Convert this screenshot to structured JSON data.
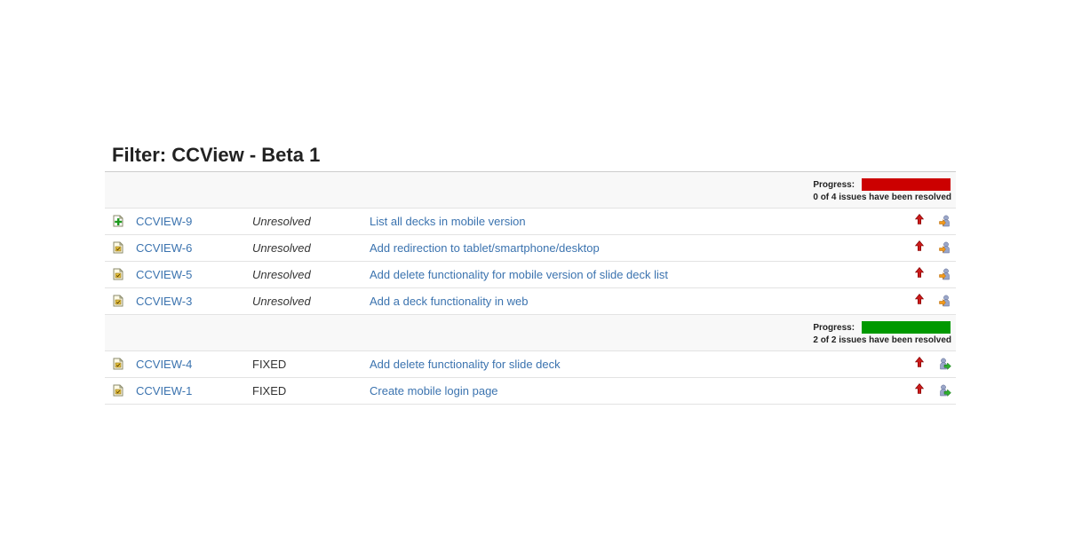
{
  "title": "Filter: CCView - Beta 1",
  "groups": [
    {
      "progress_label": "Progress:",
      "progress_fraction": 0.0,
      "progress_color": "#cc0000",
      "progress_text": "0 of 4 issues have been resolved",
      "issues": [
        {
          "type_icon": "new-feature-icon",
          "key": "CCVIEW-9",
          "status": "Unresolved",
          "summary": "List all decks in mobile version",
          "priority_icon": "priority-major-icon",
          "assignee_icon": "user-assigned-icon"
        },
        {
          "type_icon": "task-icon",
          "key": "CCVIEW-6",
          "status": "Unresolved",
          "summary": "Add redirection to tablet/smartphone/desktop",
          "priority_icon": "priority-major-icon",
          "assignee_icon": "user-assigned-icon"
        },
        {
          "type_icon": "task-icon",
          "key": "CCVIEW-5",
          "status": "Unresolved",
          "summary": "Add delete functionality for mobile version of slide deck list",
          "priority_icon": "priority-major-icon",
          "assignee_icon": "user-assigned-icon"
        },
        {
          "type_icon": "task-icon",
          "key": "CCVIEW-3",
          "status": "Unresolved",
          "summary": "Add a deck functionality in web",
          "priority_icon": "priority-major-icon",
          "assignee_icon": "user-assigned-icon"
        }
      ]
    },
    {
      "progress_label": "Progress:",
      "progress_fraction": 1.0,
      "progress_color": "#009900",
      "progress_text": "2 of 2 issues have been resolved",
      "issues": [
        {
          "type_icon": "task-icon",
          "key": "CCVIEW-4",
          "status": "FIXED",
          "summary": "Add delete functionality for slide deck",
          "priority_icon": "priority-major-icon",
          "assignee_icon": "user-resolved-icon"
        },
        {
          "type_icon": "task-icon",
          "key": "CCVIEW-1",
          "status": "FIXED",
          "summary": "Create mobile login page",
          "priority_icon": "priority-major-icon",
          "assignee_icon": "user-resolved-icon"
        }
      ]
    }
  ]
}
